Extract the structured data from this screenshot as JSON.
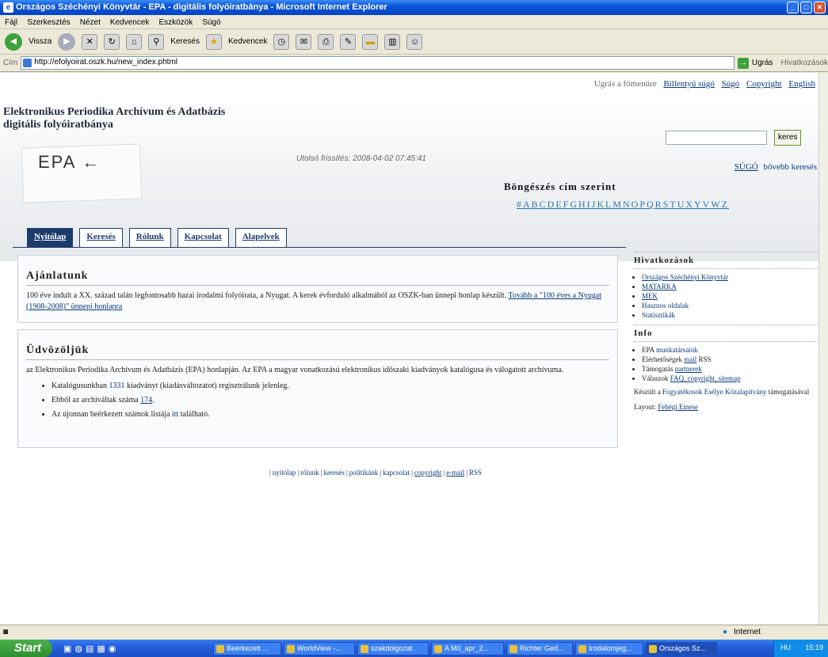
{
  "window": {
    "title": "Országos Széchényi Könyvtár - EPA - digitális folyóiratbánya - Microsoft Internet Explorer"
  },
  "menu": [
    "Fájl",
    "Szerkesztés",
    "Nézet",
    "Kedvencek",
    "Eszközök",
    "Súgó"
  ],
  "toolbar": {
    "back": "Vissza",
    "search": "Keresés",
    "favorites": "Kedvencek"
  },
  "address": {
    "label": "Cím",
    "url": "http://efolyoirat.oszk.hu/new_index.phtml",
    "go": "Ugrás",
    "links": "Hivatkozások"
  },
  "page": {
    "toplinks": {
      "skip": "Ugrás a főmenüre",
      "keyboard": "Billentyű súgó",
      "help": "Súgó",
      "copyright": "Copyright",
      "english": "English"
    },
    "site_title_1": "Elektronikus Periodika Archívum és Adatbázis",
    "site_title_2": "digitális folyóiratbánya",
    "logo": "EPA ←",
    "updated": "Utolsó frissítés: 2008-04-02 07:45:41",
    "search_button": "keres",
    "help_link": "SÚGÓ",
    "advanced_link": "bővebb keresés",
    "browse_title": "Böngészés cím szerint",
    "alphabet": "#ABCDEFGHIJKLMNOPQRSTUXYVWZ",
    "tabs": [
      "Nyitólap",
      "Keresés",
      "Rólunk",
      "Kapcsolat",
      "Alapelvek"
    ],
    "offers": {
      "title": "Ajánlatunk",
      "text": "100 éve indult a XX. század talán legfontosabb hazai irodalmi folyóirata, a Nyugat. A kerek évforduló alkalmából az OSZK-ban ünnepi honlap készült.",
      "link": "Tovább a \"100 éves a Nyugat (1908-2008)\" ünnepi honlapra"
    },
    "welcome": {
      "title": "Üdvözöljük",
      "text": "az Elektronikus Periodika Archívum és Adatbázis (EPA) honlapján. Az EPA a magyar vonatkozású elektronikus időszaki kiadványok katalógusa és válogatott archívuma.",
      "items": [
        {
          "pre": "Katalógusunkban ",
          "link": "1331",
          "post": " kiadványt (kiadásváltozatot) regisztrálunk jelenleg."
        },
        {
          "pre": "Ebből az archiváltak száma ",
          "link": "174",
          "post": "."
        },
        {
          "pre": "Az újonnan beérkezett számok listája ",
          "link": "itt",
          "post": " található."
        }
      ]
    },
    "sidebar": {
      "links_title": "Hivatkozások",
      "links": [
        "Országos Széchényi Könyvtár",
        "MATARKA",
        "MEK",
        "Hasznos oldalak",
        "Statisztikák"
      ],
      "info_title": "Info",
      "info": [
        {
          "pre": "EPA ",
          "link": "munkatársaink",
          "post": ""
        },
        {
          "pre": "Elérhetőségek ",
          "link": "mail",
          "post": " RSS"
        },
        {
          "pre": "Támogatás ",
          "link": "partnerek",
          "post": ""
        },
        {
          "pre": "Válaszok ",
          "link": "FAQ, copyright, sitemap",
          "post": ""
        }
      ],
      "credit_pre": "Készült a ",
      "credit_link": "Fogyatékosok Esélye Közalapítvány",
      "credit_post": " támogatásával",
      "layout_pre": "Layout: ",
      "layout_link": "Fehégi Emese"
    },
    "footer": [
      "nyitólap",
      "rólunk",
      "keresés",
      "politikánk",
      "kapcsolat",
      "copyright",
      "e-mail",
      "RSS"
    ]
  },
  "status": {
    "zone": "Internet"
  },
  "taskbar": {
    "start": "Start",
    "tasks": [
      "Beérkezett ...",
      "WorldView -...",
      "szakdolgozat",
      "A Mű_apr_2...",
      "Richter Ged...",
      "Irodalomjeg...",
      "Országos Sz..."
    ],
    "lang": "HU",
    "clock": "15:19"
  }
}
